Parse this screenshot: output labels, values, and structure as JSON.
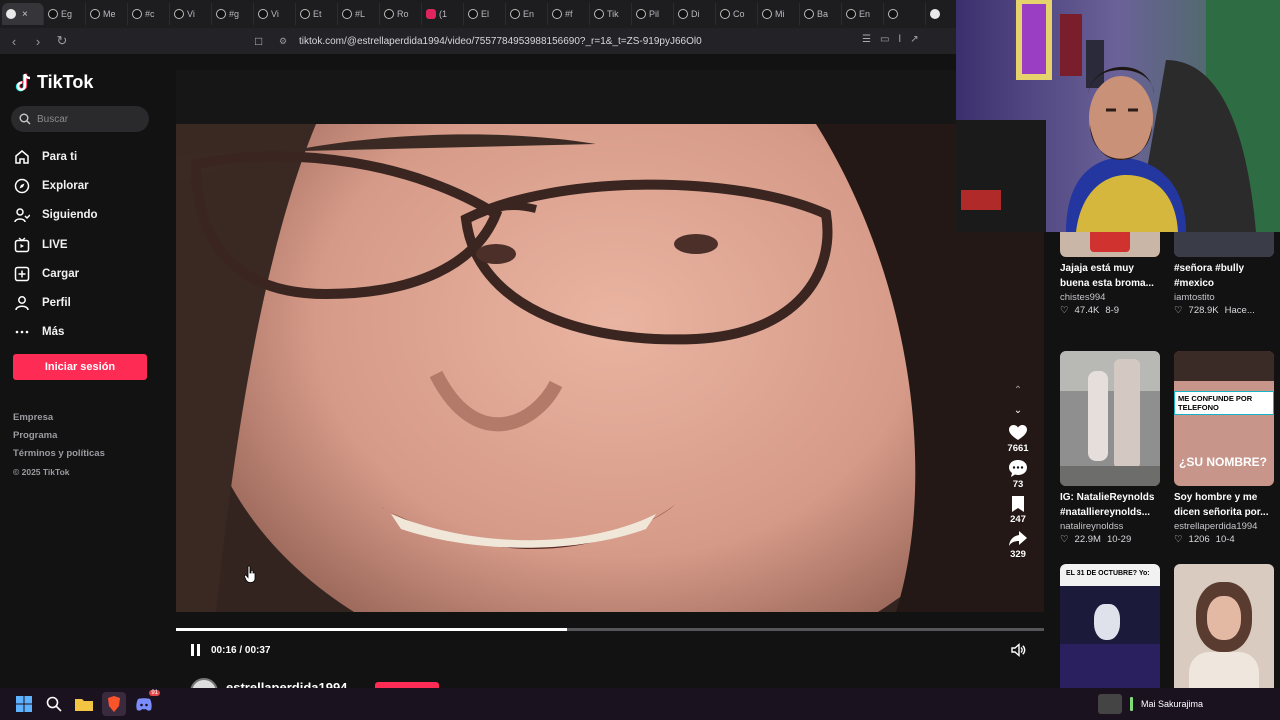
{
  "browser": {
    "tabs": [
      {
        "label": "",
        "favicon": "speaker-icon",
        "active": true
      },
      {
        "label": "Eg",
        "favicon": "tiktok-icon"
      },
      {
        "label": "Me",
        "favicon": "tiktok-icon"
      },
      {
        "label": "#c",
        "favicon": "tiktok-icon"
      },
      {
        "label": "Vi",
        "favicon": "tiktok-icon"
      },
      {
        "label": "#g",
        "favicon": "tiktok-icon"
      },
      {
        "label": "Vi",
        "favicon": "tiktok-icon"
      },
      {
        "label": "Et",
        "favicon": "tiktok-icon"
      },
      {
        "label": "#L",
        "favicon": "tiktok-icon"
      },
      {
        "label": "Ro",
        "favicon": "tiktok-icon"
      },
      {
        "label": "(1",
        "favicon": "youtube-icon"
      },
      {
        "label": "El",
        "favicon": "tiktok-icon"
      },
      {
        "label": "En",
        "favicon": "tiktok-icon"
      },
      {
        "label": "#f",
        "favicon": "tiktok-icon"
      },
      {
        "label": "Tik",
        "favicon": "tiktok-icon"
      },
      {
        "label": "Pil",
        "favicon": "tiktok-icon"
      },
      {
        "label": "Di",
        "favicon": "tiktok-icon"
      },
      {
        "label": "Co",
        "favicon": "tiktok-icon"
      },
      {
        "label": "Mi",
        "favicon": "tiktok-icon"
      },
      {
        "label": "Ba",
        "favicon": "tiktok-icon"
      },
      {
        "label": "En",
        "favicon": "tiktok-icon"
      },
      {
        "label": "",
        "favicon": "tiktok-icon"
      },
      {
        "label": "",
        "favicon": "capcut-icon"
      }
    ],
    "url": "tiktok.com/@estrellaperdida1994/video/7557784953988156690?_r=1&_t=ZS-919pyJ66Ol0"
  },
  "sidebar": {
    "brand": "TikTok",
    "search_placeholder": "Buscar",
    "nav": [
      {
        "label": "Para ti",
        "icon": "home-icon"
      },
      {
        "label": "Explorar",
        "icon": "compass-icon"
      },
      {
        "label": "Siguiendo",
        "icon": "following-icon"
      },
      {
        "label": "LIVE",
        "icon": "live-icon"
      },
      {
        "label": "Cargar",
        "icon": "upload-icon"
      },
      {
        "label": "Perfil",
        "icon": "profile-icon"
      },
      {
        "label": "Más",
        "icon": "more-icon"
      }
    ],
    "login_label": "Iniciar sesión",
    "links": [
      "Empresa",
      "Programa",
      "Términos y políticas"
    ],
    "copyright": "© 2025 TikTok"
  },
  "player": {
    "time": "00:16 / 00:37",
    "progress": 0.45,
    "username": "estrellaperdida1994",
    "actions": {
      "likes": "7661",
      "comments": "73",
      "saves": "247",
      "shares": "329"
    }
  },
  "recommendations": [
    {
      "caption": "Jajaja está muy buena esta broma...",
      "author": "chistes994",
      "views": "47.4K",
      "date": "8-9"
    },
    {
      "caption": "#señora #bully #mexico",
      "author": "iamtostito",
      "views": "728.9K",
      "date": "Hace..."
    },
    {
      "caption": "IG: NatalieReynolds #natalliereynolds...",
      "author": "natalireynoldss",
      "views": "22.9M",
      "date": "10-29"
    },
    {
      "caption": "Soy hombre y me dicen señorita por...",
      "author": "estrellaperdida1994",
      "views": "1206",
      "date": "10-4",
      "overlay_top": "ME CONFUNDE POR TELEFONO",
      "overlay_bottom": "¿SU NOMBRE?"
    },
    {
      "overlay_top": "EL 31 DE OCTUBRE? Yo:"
    },
    {}
  ],
  "taskbar": {
    "discord_badge": "91",
    "now_playing": "Mai Sakurajima"
  },
  "colors": {
    "accent": "#fe2c55",
    "background": "#121212"
  }
}
